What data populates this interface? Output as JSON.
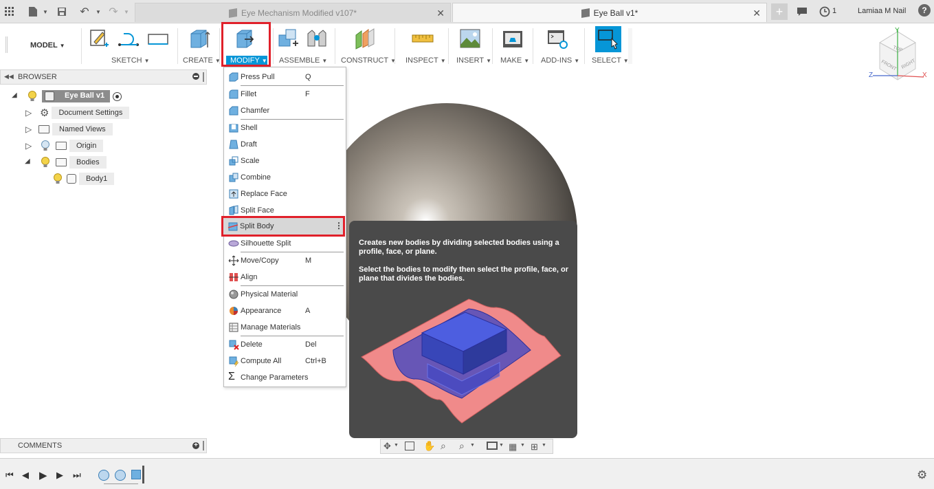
{
  "titlebar": {
    "tabs": [
      {
        "label": "Eye Mechanism Modified v107*",
        "active": false
      },
      {
        "label": "Eye Ball v1*",
        "active": true
      }
    ],
    "notification_count": "1",
    "user_name": "Lamiaa M Nail",
    "help": "?"
  },
  "toolbar": {
    "workspace": "MODEL",
    "groups": {
      "sketch": "SKETCH",
      "create": "CREATE",
      "modify": "MODIFY",
      "assemble": "ASSEMBLE",
      "construct": "CONSTRUCT",
      "inspect": "INSPECT",
      "insert": "INSERT",
      "make": "MAKE",
      "addins": "ADD-INS",
      "select": "SELECT"
    }
  },
  "browser": {
    "title": "BROWSER",
    "root": "Eye Ball v1",
    "items": [
      {
        "label": "Document Settings"
      },
      {
        "label": "Named Views"
      },
      {
        "label": "Origin"
      },
      {
        "label": "Bodies"
      },
      {
        "label": "Body1"
      }
    ]
  },
  "modify_menu": {
    "items": [
      {
        "label": "Press Pull",
        "shortcut": "Q"
      },
      {
        "label": "Fillet",
        "shortcut": "F"
      },
      {
        "label": "Chamfer",
        "shortcut": ""
      },
      {
        "label": "Shell",
        "shortcut": ""
      },
      {
        "label": "Draft",
        "shortcut": ""
      },
      {
        "label": "Scale",
        "shortcut": ""
      },
      {
        "label": "Combine",
        "shortcut": ""
      },
      {
        "label": "Replace Face",
        "shortcut": ""
      },
      {
        "label": "Split Face",
        "shortcut": ""
      },
      {
        "label": "Split Body",
        "shortcut": ""
      },
      {
        "label": "Silhouette Split",
        "shortcut": ""
      },
      {
        "label": "Move/Copy",
        "shortcut": "M"
      },
      {
        "label": "Align",
        "shortcut": ""
      },
      {
        "label": "Physical Material",
        "shortcut": ""
      },
      {
        "label": "Appearance",
        "shortcut": "A"
      },
      {
        "label": "Manage Materials",
        "shortcut": ""
      },
      {
        "label": "Delete",
        "shortcut": "Del"
      },
      {
        "label": "Compute All",
        "shortcut": "Ctrl+B"
      },
      {
        "label": "Change Parameters",
        "shortcut": ""
      }
    ],
    "highlighted": "Split Body"
  },
  "tooltip": {
    "line1": "Creates new bodies by dividing selected bodies using a profile, face, or plane.",
    "line2": "Select the bodies to modify then select the profile, face, or plane that divides the bodies."
  },
  "viewcube": {
    "top": "TOP",
    "front": "FRONT",
    "right": "RIGHT",
    "x": "X",
    "y": "Y",
    "z": "Z"
  },
  "comments": {
    "title": "COMMENTS"
  },
  "colors": {
    "accent": "#0696d7",
    "highlight_box": "#e0202a",
    "tooltip_bg": "#4a4a4a"
  }
}
